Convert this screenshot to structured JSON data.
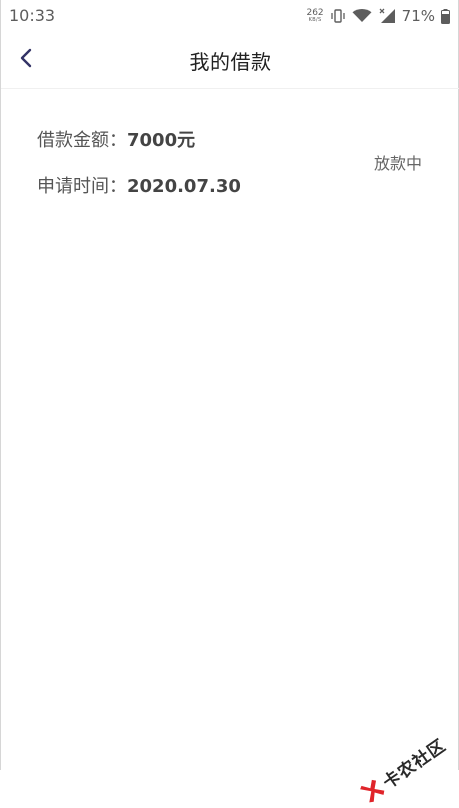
{
  "status_bar": {
    "time": "10:33",
    "net_speed_value": "262",
    "net_speed_unit": "KB/S",
    "battery_percent": "71%",
    "icons": [
      "vibrate-icon",
      "wifi-icon",
      "signal-icon",
      "battery-icon"
    ]
  },
  "header": {
    "title": "我的借款",
    "back_icon": "chevron-left-icon"
  },
  "loan": {
    "amount_label": "借款金额：",
    "amount_value": "7000元",
    "time_label": "申请时间：",
    "time_value": "2020.07.30",
    "status": "放款中"
  },
  "watermark": {
    "text": "卡农社区",
    "logo_color": "#e0242a"
  }
}
